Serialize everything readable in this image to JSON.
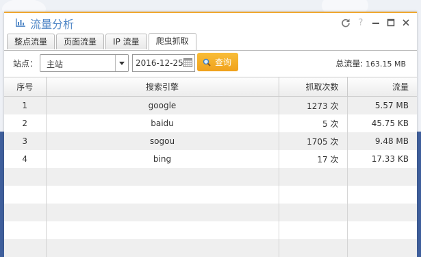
{
  "window": {
    "title": "流量分析"
  },
  "tabs": [
    {
      "label": "整点流量"
    },
    {
      "label": "页面流量"
    },
    {
      "label": "IP 流量"
    },
    {
      "label": "爬虫抓取"
    }
  ],
  "toolbar": {
    "site_label": "站点：",
    "site_value": "主站",
    "date_value": "2016-12-25",
    "query_label": "查询",
    "total_label": "总流量:",
    "total_value": "163.15 MB"
  },
  "table": {
    "headers": [
      "序号",
      "搜索引擎",
      "抓取次数",
      "流量"
    ],
    "rows": [
      {
        "index": "1",
        "engine": "google",
        "count": "1273 次",
        "traffic": "5.57 MB"
      },
      {
        "index": "2",
        "engine": "baidu",
        "count": "5 次",
        "traffic": "45.75 KB"
      },
      {
        "index": "3",
        "engine": "sogou",
        "count": "1705 次",
        "traffic": "9.48 MB"
      },
      {
        "index": "4",
        "engine": "bing",
        "count": "17 次",
        "traffic": "17.33 KB"
      }
    ]
  },
  "colors": {
    "accent": "#f0a830",
    "title": "#4f86c6",
    "button": "#f0a11b"
  }
}
